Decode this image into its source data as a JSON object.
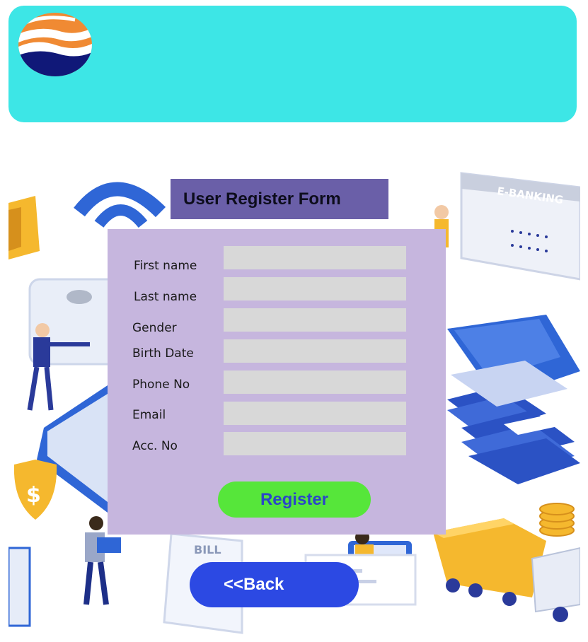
{
  "header": {
    "background_color": "#3de6e6",
    "logo_icon": "wave-globe-logo-icon"
  },
  "background_scene": {
    "icon": "e-banking-isometric-illustration",
    "banner_text": "E-BANKING",
    "bill_text": "BILL"
  },
  "form": {
    "title": "User Register Form",
    "panel_color": "#c6b6de",
    "title_color": "#6a5fa8",
    "fields": [
      {
        "label": "First name",
        "value": ""
      },
      {
        "label": "Last name",
        "value": ""
      },
      {
        "label": "Gender",
        "value": ""
      },
      {
        "label": "Birth Date",
        "value": ""
      },
      {
        "label": "Phone No",
        "value": ""
      },
      {
        "label": "Email",
        "value": ""
      },
      {
        "label": "Acc. No",
        "value": ""
      }
    ],
    "register_label": "Register"
  },
  "nav": {
    "back_label": "<<Back"
  },
  "colors": {
    "register_button": "#56e63a",
    "back_button": "#2c49e3",
    "accent_blue": "#2f66d6",
    "accent_yellow": "#f5b82e"
  }
}
